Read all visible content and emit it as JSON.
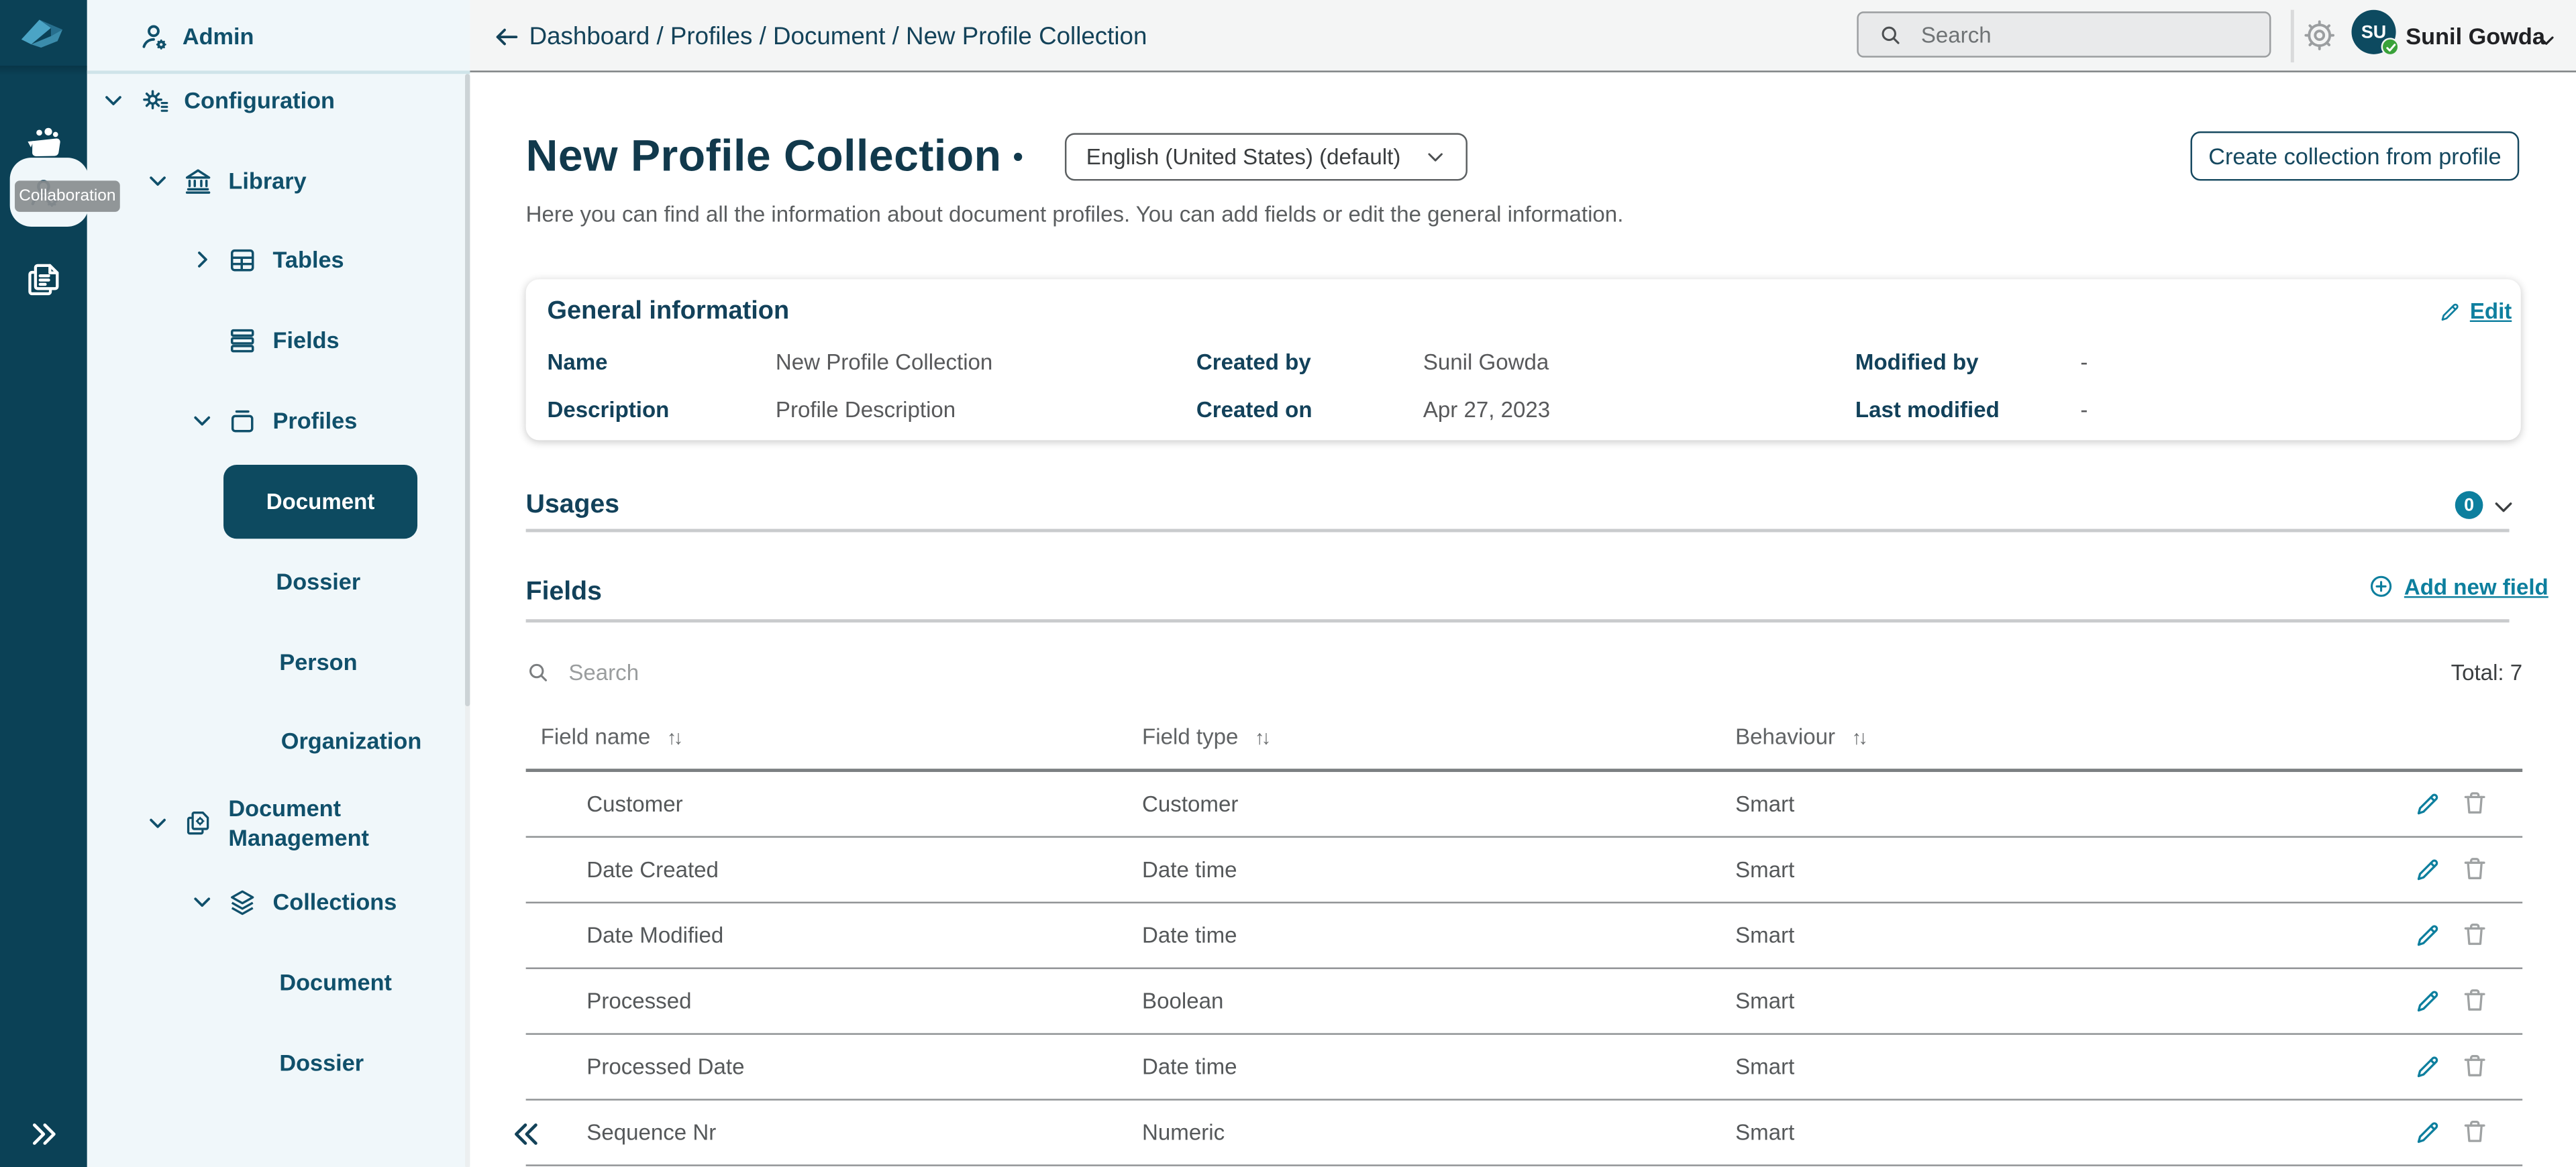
{
  "colors": {
    "rail_bg": "#0b4156",
    "sidebar_bg": "#f0f7fa",
    "active_pill": "#0d4a60",
    "dark_teal_text": "#134259",
    "accent_teal": "#0d7f9e",
    "topbar_bg": "#f4f5f5"
  },
  "rail": {
    "tooltip": "Collaboration",
    "expand_icon": "chevrons-right",
    "icons": [
      "app-logo",
      "workspace",
      "collaboration",
      "documents"
    ]
  },
  "sidebar": {
    "admin_label": "Admin",
    "items": [
      {
        "label": "Configuration"
      },
      {
        "label": "Library"
      },
      {
        "label": "Tables"
      },
      {
        "label": "Fields"
      },
      {
        "label": "Profiles"
      },
      {
        "label": "Document",
        "active": true
      },
      {
        "label": "Dossier"
      },
      {
        "label": "Person"
      },
      {
        "label": "Organization"
      },
      {
        "label": "Document Management"
      },
      {
        "label": "Collections"
      },
      {
        "label": "Document"
      },
      {
        "label": "Dossier"
      }
    ]
  },
  "topbar": {
    "breadcrumb": "Dashboard / Profiles / Document / New Profile Collection",
    "search_placeholder": "Search",
    "user": {
      "initials": "SU",
      "name": "Sunil Gowda"
    }
  },
  "page": {
    "title": "New Profile Collection",
    "language": "English (United States) (default)",
    "create_button": "Create collection from profile",
    "subtitle": "Here you can find all the information about document profiles. You can add fields or edit the general information."
  },
  "general_info": {
    "title": "General information",
    "edit_label": "Edit",
    "name_label": "Name",
    "name_value": "New Profile Collection",
    "description_label": "Description",
    "description_value": "Profile Description",
    "created_by_label": "Created by",
    "created_by_value": "Sunil Gowda",
    "created_on_label": "Created on",
    "created_on_value": "Apr 27, 2023",
    "modified_by_label": "Modified by",
    "modified_by_value": "-",
    "last_modified_label": "Last modified",
    "last_modified_value": "-"
  },
  "usages": {
    "title": "Usages",
    "count": "0"
  },
  "fields_section": {
    "title": "Fields",
    "add_label": "Add new field",
    "search_placeholder": "Search",
    "total_label": "Total: 7",
    "columns": [
      "Field name",
      "Field type",
      "Behaviour"
    ],
    "rows": [
      {
        "name": "Customer",
        "type": "Customer",
        "behaviour": "Smart"
      },
      {
        "name": "Date Created",
        "type": "Date time",
        "behaviour": "Smart"
      },
      {
        "name": "Date Modified",
        "type": "Date time",
        "behaviour": "Smart"
      },
      {
        "name": "Processed",
        "type": "Boolean",
        "behaviour": "Smart"
      },
      {
        "name": "Processed Date",
        "type": "Date time",
        "behaviour": "Smart"
      },
      {
        "name": "Sequence Nr",
        "type": "Numeric",
        "behaviour": "Smart"
      }
    ]
  }
}
